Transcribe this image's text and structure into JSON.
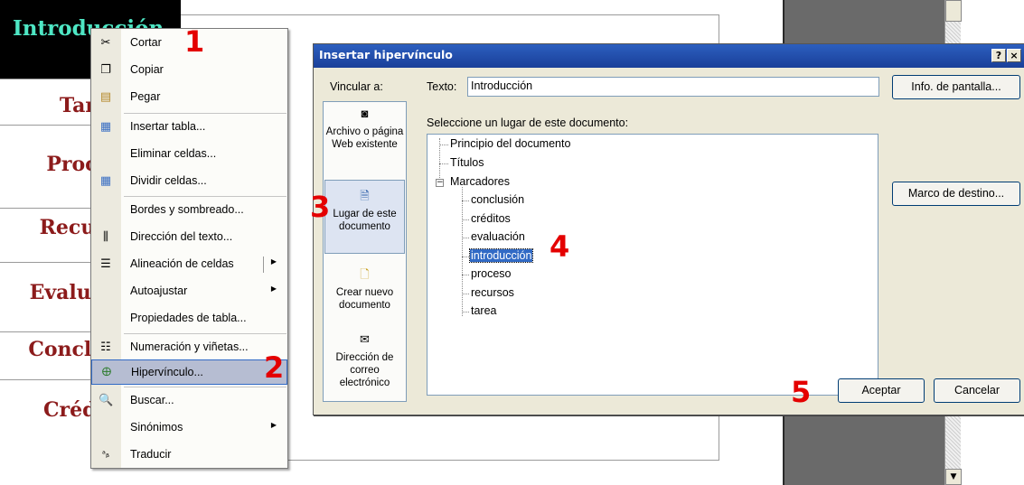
{
  "document": {
    "rows": [
      "Introducción",
      "Tarea",
      "Proceso",
      "Recursos",
      "Evaluación",
      "Conclusión",
      "Créditos"
    ]
  },
  "context_menu": {
    "items": [
      {
        "label": "Cortar",
        "icon": "scissors-icon"
      },
      {
        "label": "Copiar",
        "icon": "copy-icon"
      },
      {
        "label": "Pegar",
        "icon": "paste-icon"
      },
      {
        "label": "Insertar tabla...",
        "icon": "table-icon"
      },
      {
        "label": "Eliminar celdas...",
        "icon": ""
      },
      {
        "label": "Dividir celdas...",
        "icon": "split-cells-icon"
      },
      {
        "label": "Bordes y sombreado...",
        "icon": ""
      },
      {
        "label": "Dirección del texto...",
        "icon": "text-direction-icon"
      },
      {
        "label": "Alineación de celdas",
        "icon": "cell-align-icon"
      },
      {
        "label": "Autoajustar",
        "icon": ""
      },
      {
        "label": "Propiedades de tabla...",
        "icon": ""
      },
      {
        "label": "Numeración y viñetas...",
        "icon": "list-icon"
      },
      {
        "label": "Hipervínculo...",
        "icon": "hyperlink-icon"
      },
      {
        "label": "Buscar...",
        "icon": "search-icon"
      },
      {
        "label": "Sinónimos",
        "icon": ""
      },
      {
        "label": "Traducir",
        "icon": "translate-icon"
      }
    ]
  },
  "dialog": {
    "title": "Insertar hipervínculo",
    "help_btn": "?",
    "close_btn": "×",
    "link_to_label": "Vincular a:",
    "text_label": "Texto:",
    "text_value": "Introducción",
    "screen_tip_btn": "Info. de pantalla...",
    "place_label": "Seleccione un lugar de este documento:",
    "target_frame_btn": "Marco de destino...",
    "link_options": [
      {
        "label": "Archivo o página Web existente",
        "icon": "web-page-icon"
      },
      {
        "label": "Lugar de este documento",
        "icon": "document-place-icon"
      },
      {
        "label": "Crear nuevo documento",
        "icon": "new-document-icon"
      },
      {
        "label": "Dirección de correo electrónico",
        "icon": "email-icon"
      }
    ],
    "tree": {
      "top": "Principio del documento",
      "titles": "Títulos",
      "bookmarks": "Marcadores",
      "children": [
        "conclusión",
        "créditos",
        "evaluación",
        "introducción",
        "proceso",
        "recursos",
        "tarea"
      ],
      "selected": "introducción"
    },
    "ok_btn": "Aceptar",
    "cancel_btn": "Cancelar"
  },
  "annotations": [
    "1",
    "2",
    "3",
    "4",
    "5"
  ],
  "colors": {
    "title_bar": "#2c5fbf",
    "highlight": "#316ac5",
    "annotation": "#e40000",
    "heading_text": "#8c1b1b",
    "intro_text": "#4ee6c4"
  }
}
